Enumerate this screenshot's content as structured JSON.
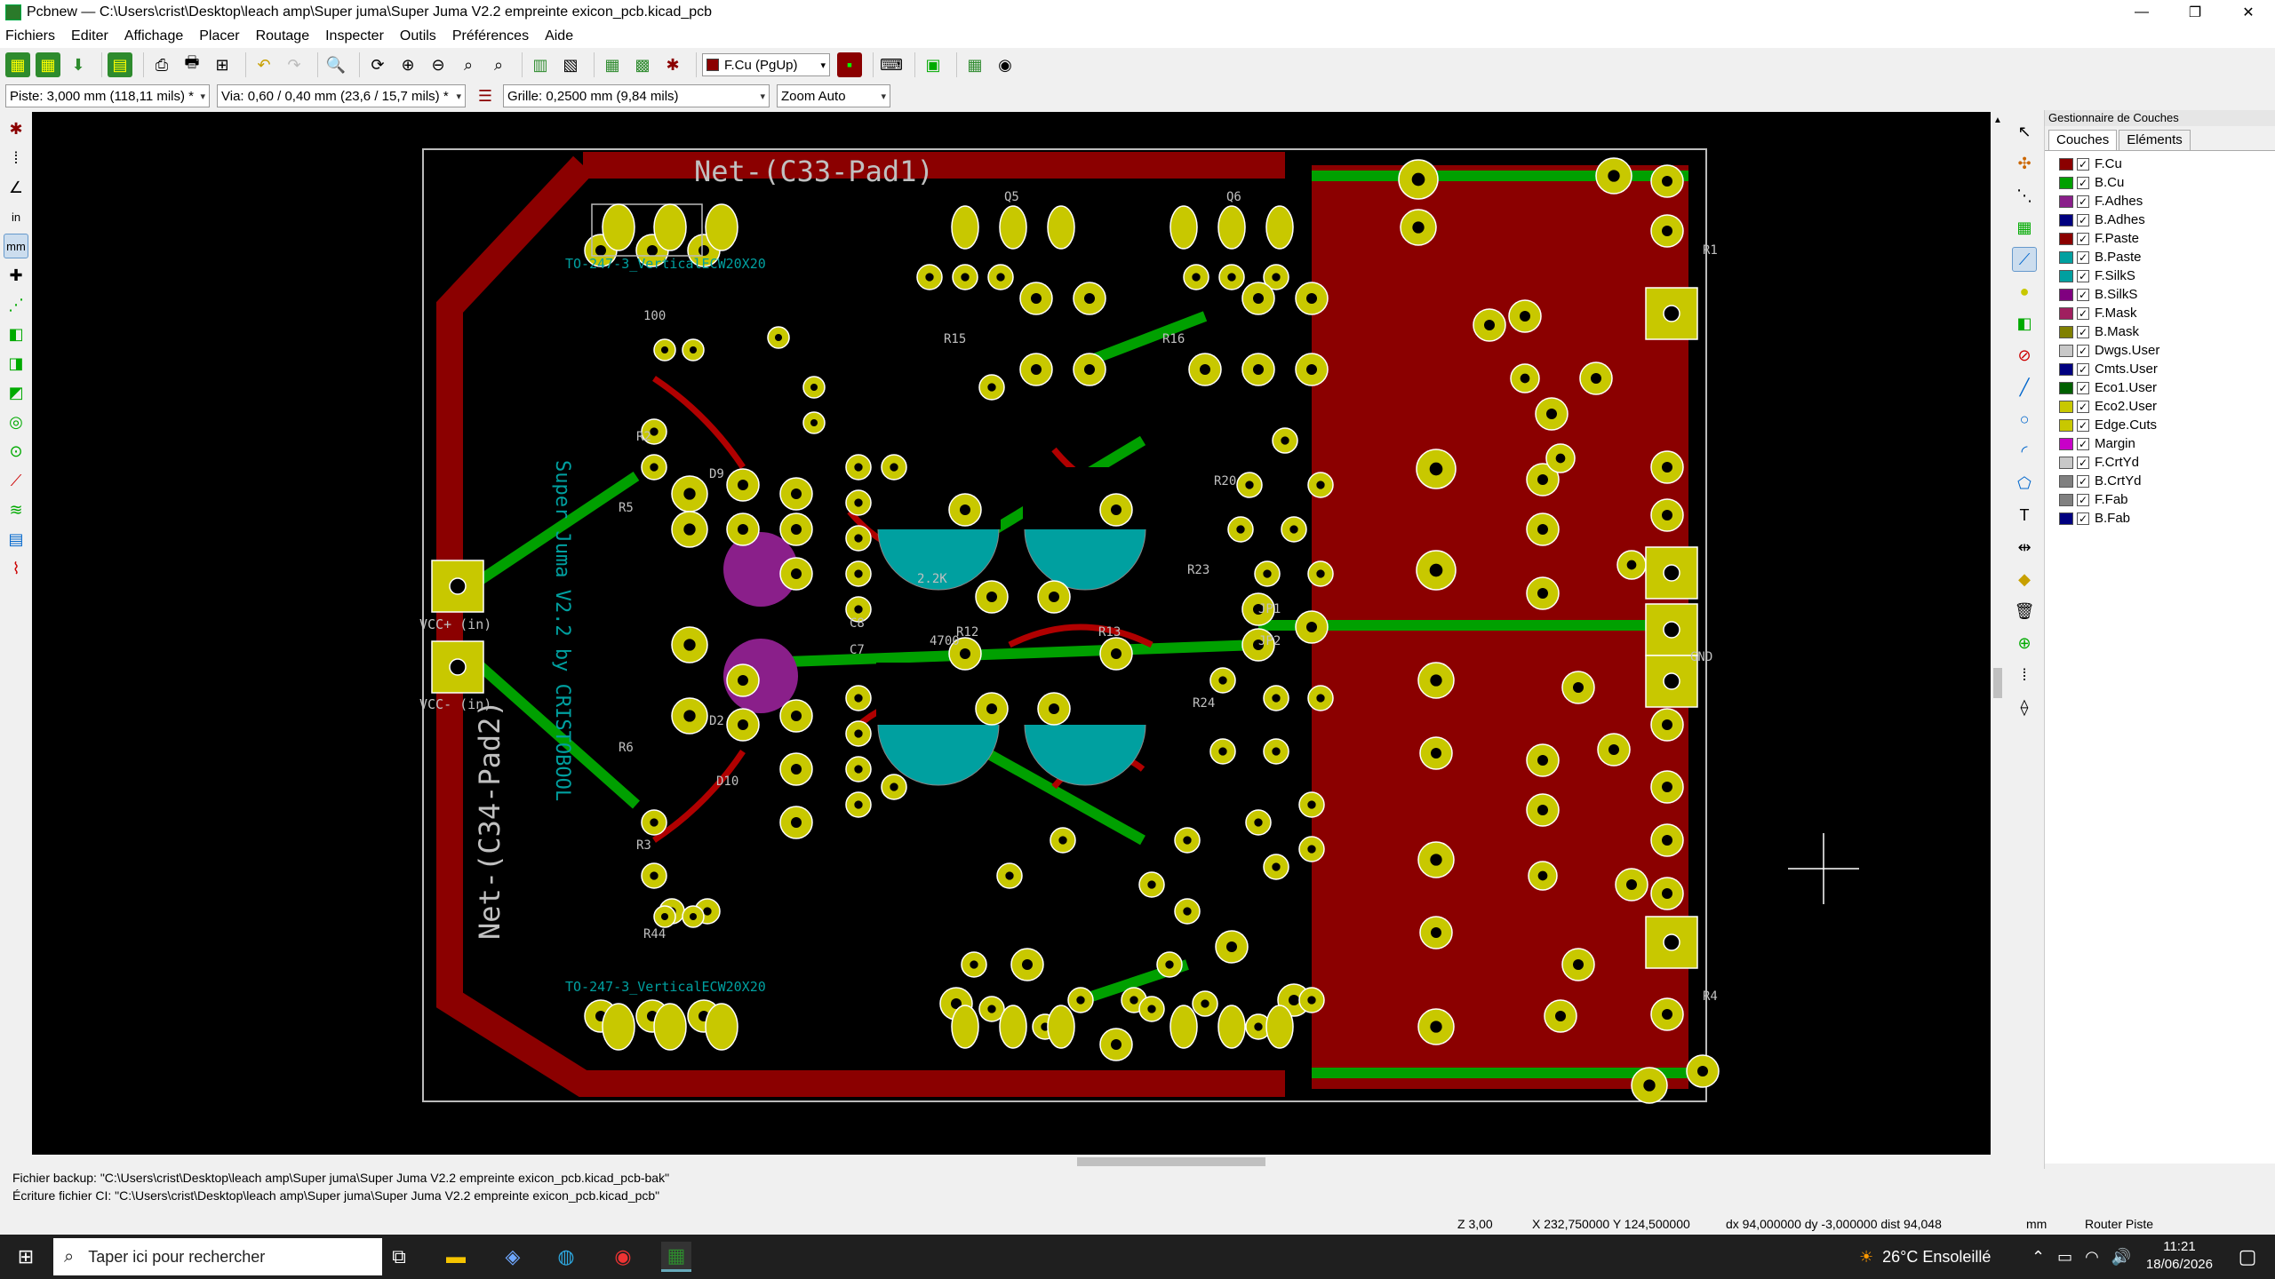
{
  "window": {
    "title": "Pcbnew — C:\\Users\\crist\\Desktop\\leach amp\\Super juma\\Super Juma V2.2 empreinte exicon_pcb.kicad_pcb",
    "minimize": "—",
    "maximize": "❐",
    "close": "✕"
  },
  "menu": [
    "Fichiers",
    "Editer",
    "Affichage",
    "Placer",
    "Routage",
    "Inspecter",
    "Outils",
    "Préférences",
    "Aide"
  ],
  "toolbar": {
    "active_layer": "F.Cu (PgUp)"
  },
  "options_bar": {
    "track": "Piste: 3,000 mm (118,11 mils) *",
    "via": "Via: 0,60 / 0,40 mm (23,6 / 15,7 mils) *",
    "grid": "Grille: 0,2500 mm (9,84 mils)",
    "zoom": "Zoom Auto"
  },
  "left_toolbar": {
    "units_in": "in",
    "units_mm": "mm"
  },
  "board": {
    "net_top": "Net-(C33-Pad1)",
    "net_left": "Net-(C34-Pad2)",
    "vertical_label": "Super Juma V2.2 by CRISTOBOOL",
    "footprint_top": "TO-247-3_VerticalECW20X20",
    "footprint_bottom": "TO-247-3_VerticalECW20X20",
    "vcc_plus": "VCC+ (in)",
    "vcc_minus": "VCC- (in)",
    "ref_labels": [
      "D9",
      "D10",
      "D2",
      "R5",
      "R6",
      "R15",
      "R16",
      "R20",
      "R23",
      "R24",
      "JP1",
      "JP2",
      "Q5",
      "Q6",
      "R1",
      "R4",
      "100",
      "2.2K",
      "R44",
      "R2",
      "R3",
      "4700",
      "R12",
      "R13",
      "C8",
      "C7",
      "GND"
    ]
  },
  "layer_panel": {
    "title": "Gestionnaire de Couches",
    "tabs": [
      "Couches",
      "Eléments"
    ],
    "layers": [
      {
        "name": "F.Cu",
        "color": "#8b0000"
      },
      {
        "name": "B.Cu",
        "color": "#00a000"
      },
      {
        "name": "F.Adhes",
        "color": "#8a1f8a"
      },
      {
        "name": "B.Adhes",
        "color": "#000080"
      },
      {
        "name": "F.Paste",
        "color": "#8b0000"
      },
      {
        "name": "B.Paste",
        "color": "#00a0a0"
      },
      {
        "name": "F.SilkS",
        "color": "#00a0a0"
      },
      {
        "name": "B.SilkS",
        "color": "#800080"
      },
      {
        "name": "F.Mask",
        "color": "#a01f5f"
      },
      {
        "name": "B.Mask",
        "color": "#808000"
      },
      {
        "name": "Dwgs.User",
        "color": "#c8c8c8"
      },
      {
        "name": "Cmts.User",
        "color": "#000080"
      },
      {
        "name": "Eco1.User",
        "color": "#006000"
      },
      {
        "name": "Eco2.User",
        "color": "#c8c800"
      },
      {
        "name": "Edge.Cuts",
        "color": "#c8c800"
      },
      {
        "name": "Margin",
        "color": "#c800c8"
      },
      {
        "name": "F.CrtYd",
        "color": "#c8c8c8"
      },
      {
        "name": "B.CrtYd",
        "color": "#808080"
      },
      {
        "name": "F.Fab",
        "color": "#808080"
      },
      {
        "name": "B.Fab",
        "color": "#000080"
      }
    ]
  },
  "messages": [
    "Fichier backup: \"C:\\Users\\crist\\Desktop\\leach amp\\Super juma\\Super Juma V2.2 empreinte exicon_pcb.kicad_pcb-bak\"",
    "Écriture fichier CI: \"C:\\Users\\crist\\Desktop\\leach amp\\Super juma\\Super Juma V2.2 empreinte exicon_pcb.kicad_pcb\""
  ],
  "status": {
    "zoom": "Z 3,00",
    "coords": "X 232,750000  Y 124,500000",
    "delta": "dx 94,000000  dy -3,000000  dist 94,048",
    "units": "mm",
    "mode": "Router Piste"
  },
  "taskbar": {
    "search_placeholder": "Taper ici pour rechercher",
    "weather": "26°C Ensoleillé",
    "time": "11:21",
    "date": "18/06/2026"
  }
}
